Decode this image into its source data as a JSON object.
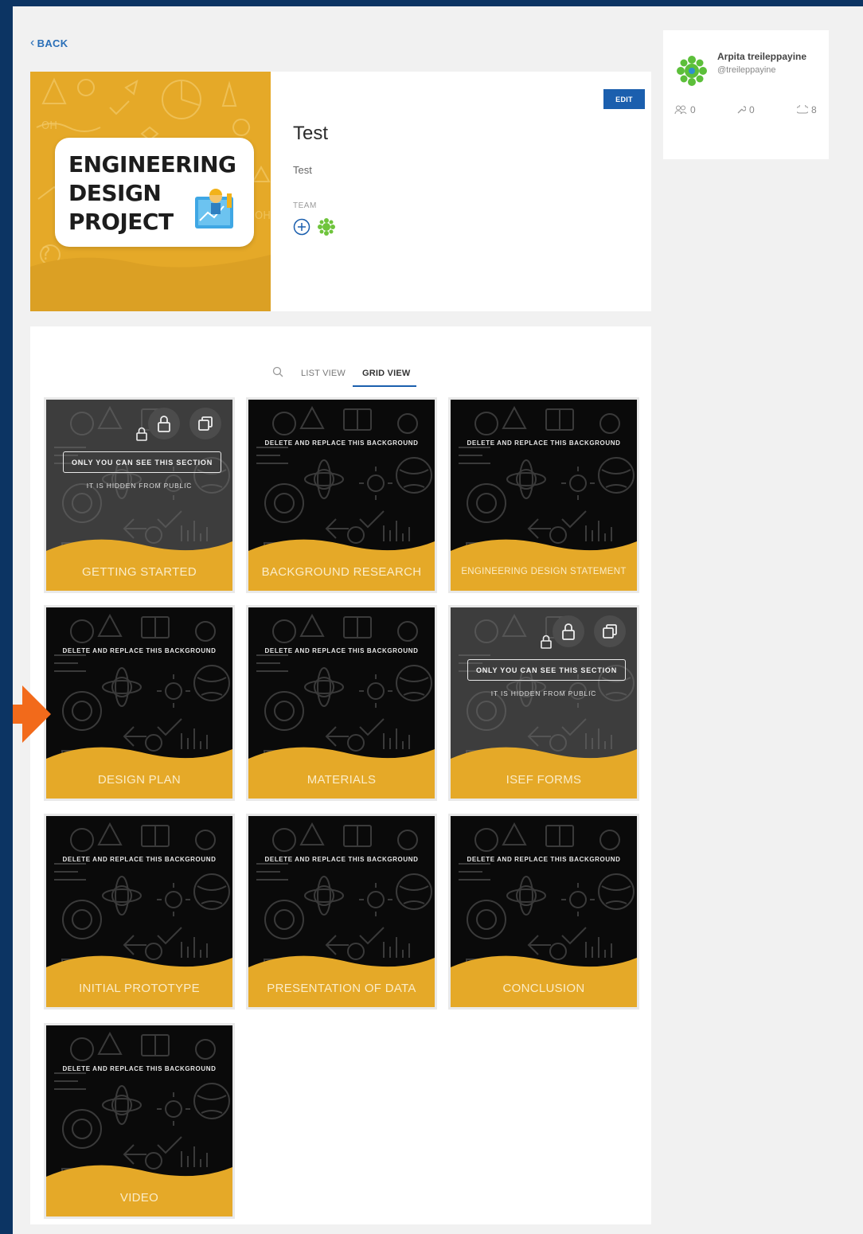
{
  "nav": {
    "back_label": "BACK"
  },
  "project": {
    "cover_lines": [
      "ENGINEERING",
      "DESIGN",
      "PROJECT"
    ],
    "title": "Test",
    "description": "Test",
    "team_label": "TEAM",
    "edit_label": "EDIT"
  },
  "profile": {
    "name": "Arpita treileppayine",
    "handle": "@treileppayine",
    "stats": {
      "followers": "0",
      "tools": "0",
      "projects": "8"
    }
  },
  "view_tabs": {
    "list": "LIST VIEW",
    "grid": "GRID VIEW",
    "active": "grid"
  },
  "sections": [
    {
      "caption": "GETTING STARTED",
      "private": true,
      "note": ""
    },
    {
      "caption": "BACKGROUND RESEARCH",
      "private": false,
      "note": "DELETE AND REPLACE THIS BACKGROUND"
    },
    {
      "caption": "ENGINEERING DESIGN STATEMENT",
      "private": false,
      "note": "DELETE AND REPLACE THIS BACKGROUND"
    },
    {
      "caption": "DESIGN PLAN",
      "private": false,
      "note": "DELETE AND REPLACE THIS BACKGROUND"
    },
    {
      "caption": "MATERIALS",
      "private": false,
      "note": "DELETE AND REPLACE THIS BACKGROUND"
    },
    {
      "caption": "ISEF FORMS",
      "private": true,
      "note": ""
    },
    {
      "caption": "INITIAL PROTOTYPE",
      "private": false,
      "note": "DELETE AND REPLACE THIS BACKGROUND"
    },
    {
      "caption": "PRESENTATION OF DATA",
      "private": false,
      "note": "DELETE AND REPLACE THIS BACKGROUND"
    },
    {
      "caption": "CONCLUSION",
      "private": false,
      "note": "DELETE AND REPLACE THIS BACKGROUND"
    },
    {
      "caption": "VIDEO",
      "private": false,
      "note": "DELETE AND REPLACE THIS BACKGROUND"
    }
  ],
  "private_section": {
    "notice": "ONLY YOU CAN SEE THIS SECTION",
    "subnotice": "IT IS HIDDEN FROM PUBLIC"
  },
  "colors": {
    "frame": "#0c3463",
    "accent_gold": "#e5a928",
    "primary_blue": "#1b5fae",
    "pointer_orange": "#f26a1b"
  }
}
